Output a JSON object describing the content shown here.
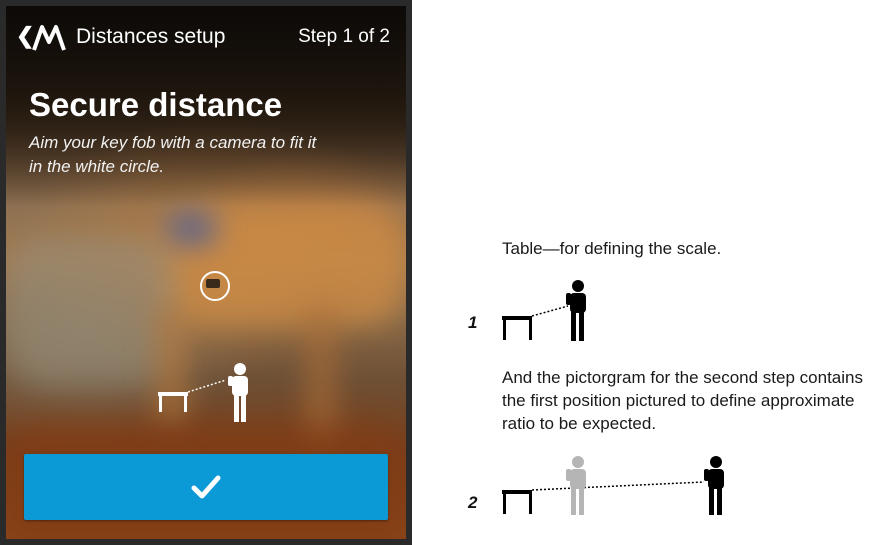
{
  "app": {
    "back_icon": "chevron-left-icon",
    "logo_icon": "motorola-logo-icon",
    "title": "Distances setup",
    "step": "Step 1 of 2"
  },
  "screen": {
    "heading": "Secure distance",
    "instruction": "Aim your key fob with a camera to fit it in the white circle.",
    "confirm_icon": "checkmark-icon",
    "accent_color": "#0c9ad6"
  },
  "notes": {
    "table_caption": "Table—for defining the scale.",
    "step1_number": "1",
    "pictogram_caption": "And the pictorgram for the second step contains the first position pictured to define approximate ratio to be expected.",
    "step2_number": "2"
  }
}
